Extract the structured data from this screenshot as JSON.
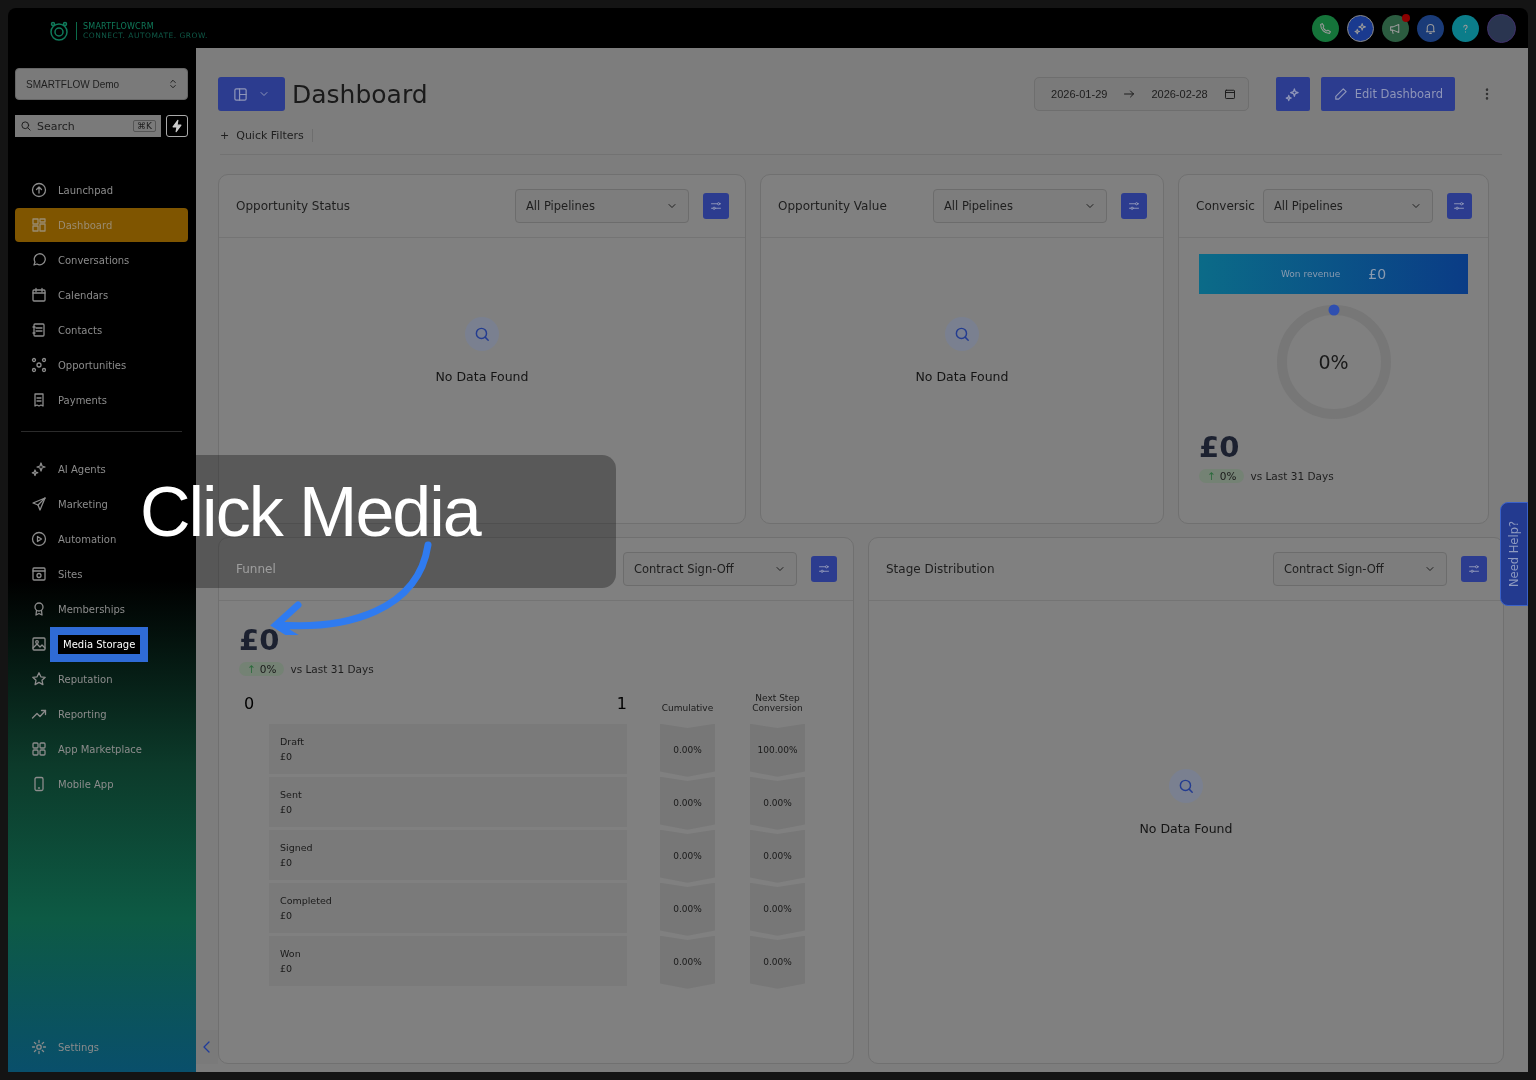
{
  "brand": {
    "name": "SMARTFLOWCRM",
    "tagline": "CONNECT. AUTOMATE. GROW."
  },
  "account_switcher": {
    "value": "SMARTFLOW Demo"
  },
  "search": {
    "placeholder": "Search",
    "shortcut": "⌘K"
  },
  "sidebar": {
    "primary": [
      {
        "label": "Launchpad",
        "selected": false,
        "highlighted": false
      },
      {
        "label": "Dashboard",
        "selected": true,
        "highlighted": false
      },
      {
        "label": "Conversations",
        "selected": false,
        "highlighted": false
      },
      {
        "label": "Calendars",
        "selected": false,
        "highlighted": false
      },
      {
        "label": "Contacts",
        "selected": false,
        "highlighted": false
      },
      {
        "label": "Opportunities",
        "selected": false,
        "highlighted": false
      },
      {
        "label": "Payments",
        "selected": false,
        "highlighted": false
      }
    ],
    "secondary": [
      {
        "label": "AI Agents",
        "selected": false,
        "highlighted": false
      },
      {
        "label": "Marketing",
        "selected": false,
        "highlighted": false
      },
      {
        "label": "Automation",
        "selected": false,
        "highlighted": false
      },
      {
        "label": "Sites",
        "selected": false,
        "highlighted": false
      },
      {
        "label": "Memberships",
        "selected": false,
        "highlighted": false
      },
      {
        "label": "Media Storage",
        "selected": false,
        "highlighted": true
      },
      {
        "label": "Reputation",
        "selected": false,
        "highlighted": false
      },
      {
        "label": "Reporting",
        "selected": false,
        "highlighted": false
      },
      {
        "label": "App Marketplace",
        "selected": false,
        "highlighted": false
      },
      {
        "label": "Mobile App",
        "selected": false,
        "highlighted": false
      }
    ],
    "settings": "Settings"
  },
  "header": {
    "title": "Dashboard",
    "date_from": "2026-01-29",
    "date_to": "2026-02-28",
    "edit_button": "Edit Dashboard",
    "quick_filters": "Quick Filters",
    "quick_filters_prefix": "+"
  },
  "notifications": {
    "unread": true
  },
  "cards": [
    {
      "kind": "empty",
      "title": "Opportunity Status",
      "filter": "All Pipelines",
      "message": "No Data Found"
    },
    {
      "kind": "empty",
      "title": "Opportunity Value",
      "filter": "All Pipelines",
      "message": "No Data Found"
    },
    {
      "kind": "conversion",
      "title": "Conversic",
      "filter": "All Pipelines",
      "banner_label": "Won revenue",
      "banner_value": "£0",
      "gauge": "0%",
      "total": "£0",
      "change_arrow": "↑",
      "change": "0%",
      "comparison": "vs Last 31 Days"
    }
  ],
  "funnel": {
    "title": "Funnel",
    "filter": "Contract Sign-Off",
    "total": "£0",
    "change_arrow": "↑",
    "change": "0%",
    "comparison": "vs Last 31 Days",
    "axis_min": "0",
    "axis_max": "1",
    "col_cumulative": "Cumulative",
    "col_next": "Next Step Conversion",
    "stages": [
      {
        "name": "Draft",
        "value": "£0",
        "cumulative": "0.00%",
        "next": "100.00%"
      },
      {
        "name": "Sent",
        "value": "£0",
        "cumulative": "0.00%",
        "next": "0.00%"
      },
      {
        "name": "Signed",
        "value": "£0",
        "cumulative": "0.00%",
        "next": "0.00%"
      },
      {
        "name": "Completed",
        "value": "£0",
        "cumulative": "0.00%",
        "next": "0.00%"
      },
      {
        "name": "Won",
        "value": "£0",
        "cumulative": "0.00%",
        "next": "0.00%"
      }
    ]
  },
  "stage_distribution": {
    "title": "Stage Distribution",
    "filter": "Contract Sign-Off",
    "message": "No Data Found"
  },
  "help_tab": "Need Help?",
  "tutorial": {
    "caption": "Click Media"
  }
}
